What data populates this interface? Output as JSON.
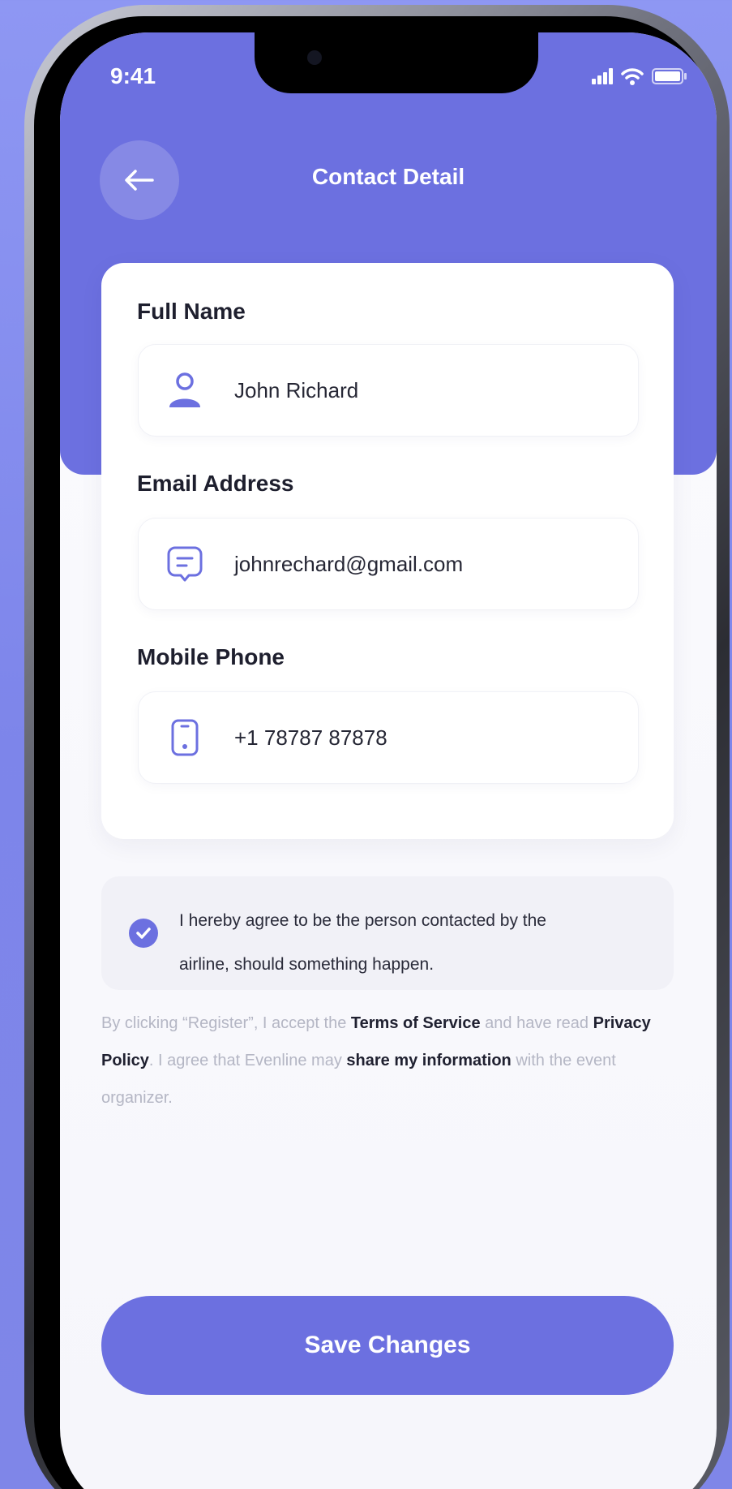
{
  "status_bar": {
    "time": "9:41"
  },
  "header": {
    "title": "Contact Detail"
  },
  "form": {
    "full_name": {
      "label": "Full Name",
      "value": "John Richard",
      "icon": "user-icon"
    },
    "email": {
      "label": "Email Address",
      "value": "johnrechard@gmail.com",
      "icon": "message-icon"
    },
    "phone": {
      "label": "Mobile Phone",
      "value": "+1 78787 87878",
      "icon": "phone-icon"
    }
  },
  "agreement": {
    "checked": true,
    "line1": "I hereby agree to be the person contacted by the",
    "line2": "airline, should something happen."
  },
  "legal": {
    "part1": "By clicking “Register”, I accept the ",
    "terms_link": "Terms of Service",
    "part2": " and have read ",
    "privacy_link": "Privacy Policy",
    "part3": ". I agree that Evenline may ",
    "share_link": "share my information",
    "part4": " with the event organizer."
  },
  "actions": {
    "save_label": "Save Changes"
  },
  "colors": {
    "accent": "#6c70e0",
    "background": "#8e97f3"
  }
}
